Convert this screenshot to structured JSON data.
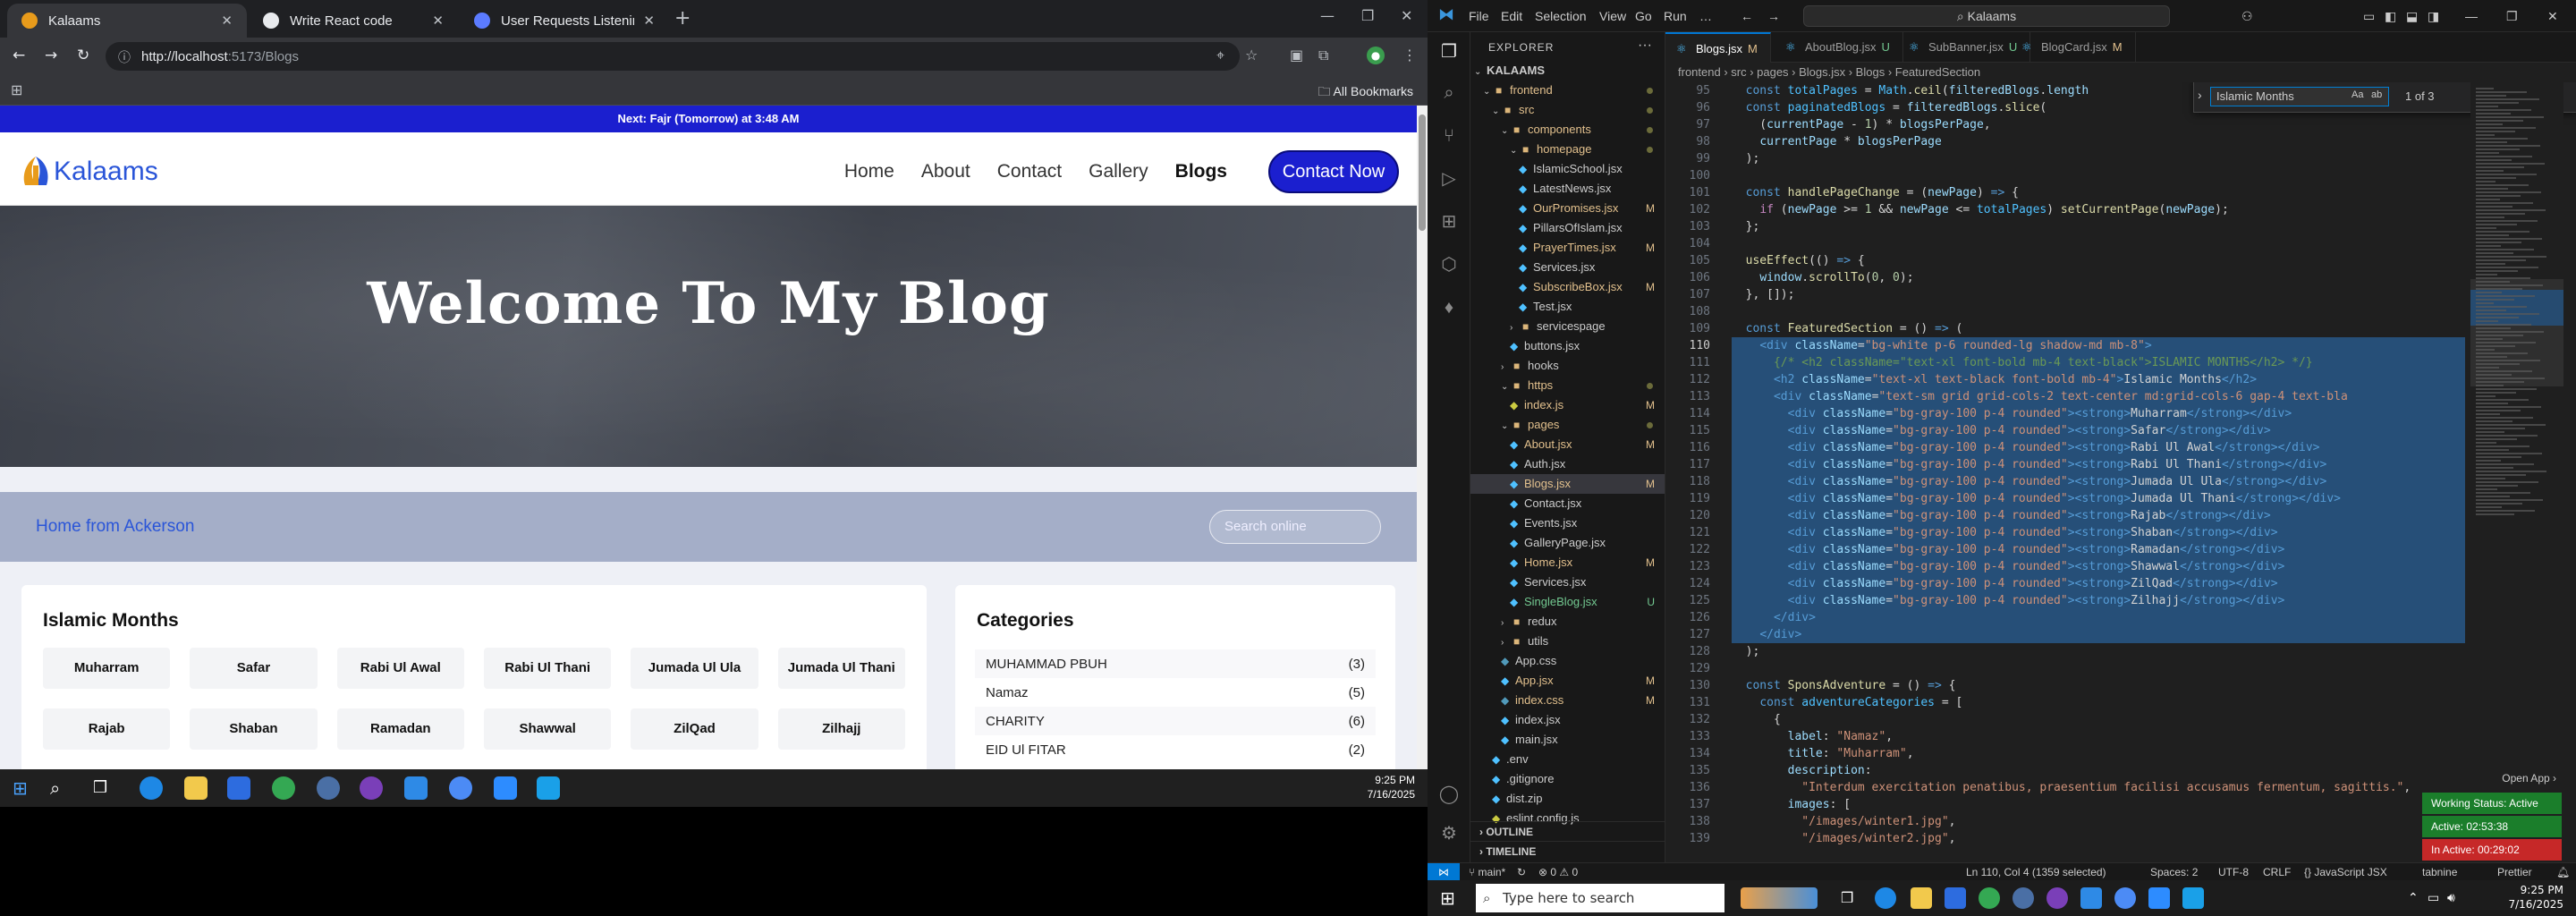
{
  "browser": {
    "tabs": [
      {
        "title": "Kalaams"
      },
      {
        "title": "Write React code"
      },
      {
        "title": "User Requests Listening Assista"
      }
    ],
    "url_host": "http://localhost",
    "url_path": ":5173/Blogs",
    "all_bookmarks": "All Bookmarks"
  },
  "site": {
    "prayer_bar_prefix": "Next: ",
    "prayer_name": "Fajr (Tomorrow)",
    "prayer_suffix": " at 3:48 AM",
    "logo_text": "Kalaams",
    "nav": [
      "Home",
      "About",
      "Contact",
      "Gallery",
      "Blogs"
    ],
    "contact_button": "Contact Now",
    "hero_title": "Welcome To My Blog",
    "subhero_link": "Home from Ackerson",
    "search_placeholder": "Search online",
    "months_title": "Islamic Months",
    "months": [
      "Muharram",
      "Safar",
      "Rabi Ul Awal",
      "Rabi Ul Thani",
      "Jumada Ul Ula",
      "Jumada Ul Thani",
      "Rajab",
      "Shaban",
      "Ramadan",
      "Shawwal",
      "ZilQad",
      "Zilhajj"
    ],
    "categories_title": "Categories",
    "categories": [
      {
        "name": "MUHAMMAD PBUH",
        "count": "(3)"
      },
      {
        "name": "Namaz",
        "count": "(5)"
      },
      {
        "name": "CHARITY",
        "count": "(6)"
      },
      {
        "name": "EID Ul FITAR",
        "count": "(2)"
      }
    ]
  },
  "taskbar_left": {
    "time": "9:25 PM",
    "date": "7/16/2025"
  },
  "vscode": {
    "menu": [
      "File",
      "Edit",
      "Selection",
      "View",
      "Go",
      "Run",
      "…"
    ],
    "command_center": "Kalaams",
    "explorer_label": "EXPLORER",
    "tree": [
      {
        "label": "KALAAMS",
        "indent": 0,
        "chev": "⌄",
        "type": "root"
      },
      {
        "label": "frontend",
        "indent": 1,
        "chev": "⌄",
        "type": "folder",
        "state": "mod"
      },
      {
        "label": "src",
        "indent": 2,
        "chev": "⌄",
        "type": "folder",
        "state": "mod"
      },
      {
        "label": "components",
        "indent": 3,
        "chev": "⌄",
        "type": "folder",
        "state": "mod"
      },
      {
        "label": "homepage",
        "indent": 4,
        "chev": "⌄",
        "type": "folder",
        "state": "mod"
      },
      {
        "label": "IslamicSchool.jsx",
        "indent": 5,
        "type": "file"
      },
      {
        "label": "LatestNews.jsx",
        "indent": 5,
        "type": "file"
      },
      {
        "label": "OurPromises.jsx",
        "indent": 5,
        "type": "file",
        "state": "mod",
        "badge": "M"
      },
      {
        "label": "PillarsOfIslam.jsx",
        "indent": 5,
        "type": "file"
      },
      {
        "label": "PrayerTimes.jsx",
        "indent": 5,
        "type": "file",
        "state": "mod",
        "badge": "M"
      },
      {
        "label": "Services.jsx",
        "indent": 5,
        "type": "file"
      },
      {
        "label": "SubscribeBox.jsx",
        "indent": 5,
        "type": "file",
        "state": "mod",
        "badge": "M"
      },
      {
        "label": "Test.jsx",
        "indent": 5,
        "type": "file"
      },
      {
        "label": "servicespage",
        "indent": 4,
        "chev": "›",
        "type": "folder"
      },
      {
        "label": "buttons.jsx",
        "indent": 4,
        "type": "file"
      },
      {
        "label": "hooks",
        "indent": 3,
        "chev": "›",
        "type": "folder"
      },
      {
        "label": "https",
        "indent": 3,
        "chev": "⌄",
        "type": "folder",
        "state": "mod"
      },
      {
        "label": "index.js",
        "indent": 4,
        "type": "file",
        "state": "mod",
        "badge": "M"
      },
      {
        "label": "pages",
        "indent": 3,
        "chev": "⌄",
        "type": "folder",
        "state": "mod"
      },
      {
        "label": "About.jsx",
        "indent": 4,
        "type": "file",
        "state": "mod",
        "badge": "M"
      },
      {
        "label": "Auth.jsx",
        "indent": 4,
        "type": "file"
      },
      {
        "label": "Blogs.jsx",
        "indent": 4,
        "type": "file",
        "state": "mod",
        "badge": "M",
        "selected": true
      },
      {
        "label": "Contact.jsx",
        "indent": 4,
        "type": "file"
      },
      {
        "label": "Events.jsx",
        "indent": 4,
        "type": "file"
      },
      {
        "label": "GalleryPage.jsx",
        "indent": 4,
        "type": "file"
      },
      {
        "label": "Home.jsx",
        "indent": 4,
        "type": "file",
        "state": "mod",
        "badge": "M"
      },
      {
        "label": "Services.jsx",
        "indent": 4,
        "type": "file"
      },
      {
        "label": "SingleBlog.jsx",
        "indent": 4,
        "type": "file",
        "state": "untr",
        "badge": "U"
      },
      {
        "label": "redux",
        "indent": 3,
        "chev": "›",
        "type": "folder"
      },
      {
        "label": "utils",
        "indent": 3,
        "chev": "›",
        "type": "folder"
      },
      {
        "label": "App.css",
        "indent": 3,
        "type": "file"
      },
      {
        "label": "App.jsx",
        "indent": 3,
        "type": "file",
        "state": "mod",
        "badge": "M"
      },
      {
        "label": "index.css",
        "indent": 3,
        "type": "file",
        "state": "mod",
        "badge": "M"
      },
      {
        "label": "index.jsx",
        "indent": 3,
        "type": "file"
      },
      {
        "label": "main.jsx",
        "indent": 3,
        "type": "file"
      },
      {
        "label": ".env",
        "indent": 2,
        "type": "file"
      },
      {
        "label": ".gitignore",
        "indent": 2,
        "type": "file"
      },
      {
        "label": "dist.zip",
        "indent": 2,
        "type": "file"
      },
      {
        "label": "eslint.config.js",
        "indent": 2,
        "type": "file"
      }
    ],
    "outline_label": "OUTLINE",
    "timeline_label": "TIMELINE",
    "tabs": [
      {
        "name": "Blogs.jsx",
        "flag": "M"
      },
      {
        "name": "AboutBlog.jsx",
        "flag": "U"
      },
      {
        "name": "SubBanner.jsx",
        "flag": "U"
      },
      {
        "name": "BlogCard.jsx",
        "flag": "M"
      }
    ],
    "breadcrumb": "frontend › src › pages › Blogs.jsx › Blogs › FeaturedSection",
    "find_query": "Islamic Months",
    "find_count": "1 of 3",
    "line_numbers": [
      95,
      96,
      97,
      98,
      99,
      100,
      101,
      102,
      103,
      104,
      105,
      106,
      107,
      108,
      109,
      110,
      111,
      112,
      113,
      114,
      115,
      116,
      117,
      118,
      119,
      120,
      121,
      122,
      123,
      124,
      125,
      126,
      127,
      128,
      129,
      130,
      131,
      132,
      133,
      134,
      135,
      136,
      137,
      138,
      139
    ],
    "current_line": 110,
    "status": {
      "branch": "main*",
      "sync": "↻",
      "problems": "⊗ 0 ⚠ 0",
      "position": "Ln 110, Col 4 (1359 selected)",
      "spaces": "Spaces: 2",
      "encoding": "UTF-8",
      "eol": "CRLF",
      "language": "{} JavaScript JSX",
      "extension": "tabnine",
      "prettier": "Prettier"
    },
    "notifications": {
      "open_app": "Open App ›",
      "working_status": "Working Status: Active",
      "active": "Active: 02:53:38",
      "inactive": "In Active: 00:29:02"
    }
  },
  "taskbar_bottom": {
    "search_placeholder": "Type here to search",
    "time": "9:25 PM",
    "date": "7/16/2025"
  }
}
